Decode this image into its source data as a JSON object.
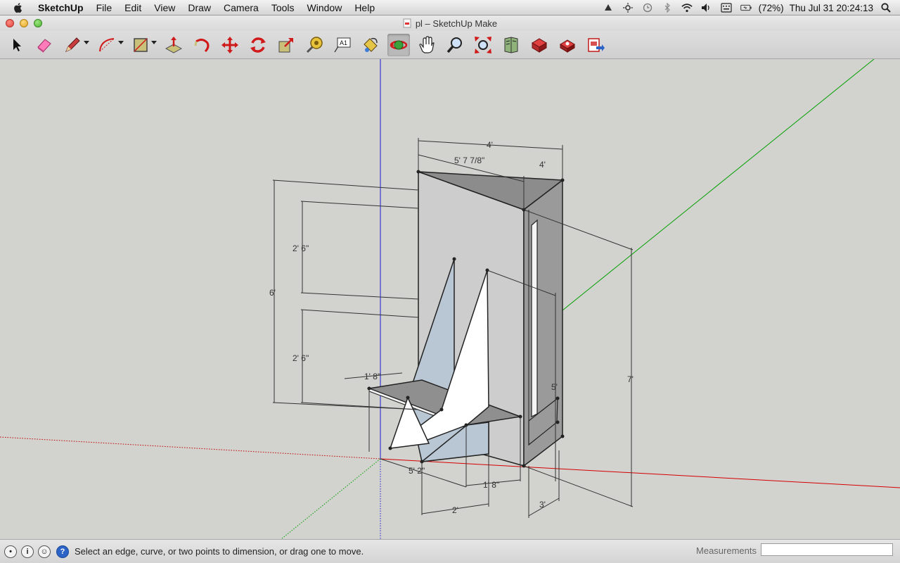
{
  "menubar": {
    "items": [
      "SketchUp",
      "File",
      "Edit",
      "View",
      "Draw",
      "Camera",
      "Tools",
      "Window",
      "Help"
    ],
    "battery": "(72%)",
    "clock": "Thu Jul 31  20:24:13"
  },
  "window": {
    "title": "pl – SketchUp Make"
  },
  "toolbar": {
    "tools": [
      "select-tool",
      "eraser-tool",
      "pencil-tool",
      "arc-tool",
      "rectangle-tool",
      "push-pull-tool",
      "follow-me-tool",
      "move-tool",
      "rotate-tool",
      "scale-tool",
      "tape-measure-tool",
      "text-tool",
      "paint-bucket-tool",
      "orbit-tool",
      "pan-tool",
      "zoom-tool",
      "zoom-extents-tool",
      "warehouse-tool",
      "components-tool",
      "extension-tool",
      "send-to-layout-tool"
    ],
    "active_tool": "orbit-tool"
  },
  "model": {
    "dimensions": [
      "4'",
      "5' 7 7/8\"",
      "4'",
      "6'",
      "2' 6\"",
      "2' 6\"",
      "1' 8\"",
      "7'",
      "5'",
      "5' 2\"",
      "1' 8\"",
      "2'",
      "3'"
    ]
  },
  "statusbar": {
    "message": "Select an edge, curve, or two points to dimension, or drag one to move.",
    "measurements_label": "Measurements",
    "measurements_value": ""
  },
  "colors": {
    "canvas": "#d2d2ce",
    "axis_red": "#d40000",
    "axis_green": "#00a000",
    "axis_blue": "#1a1ad0",
    "face_front": "#cdcdcd",
    "face_back": "#b9c6d3",
    "face_dark": "#8c8c8c"
  }
}
